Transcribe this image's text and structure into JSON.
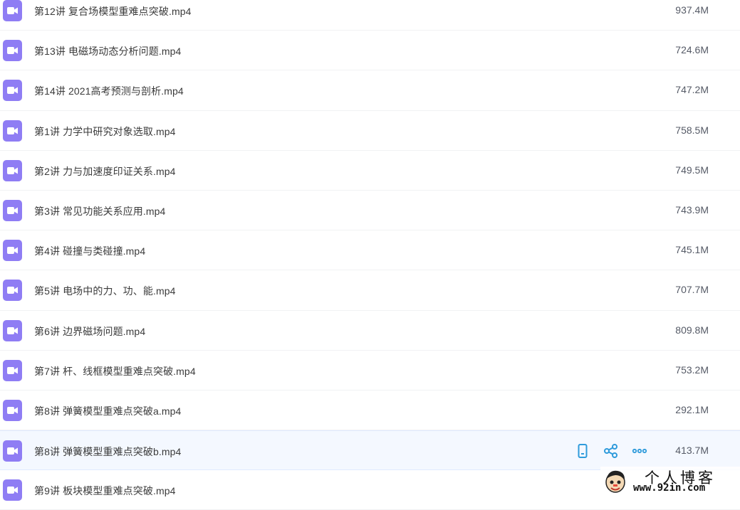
{
  "files": [
    {
      "name": "第12讲 复合场模型重难点突破.mp4",
      "size": "937.4M",
      "icon": "video-file-icon"
    },
    {
      "name": "第13讲 电磁场动态分析问题.mp4",
      "size": "724.6M",
      "icon": "video-file-icon"
    },
    {
      "name": "第14讲 2021高考预测与剖析.mp4",
      "size": "747.2M",
      "icon": "video-file-icon"
    },
    {
      "name": "第1讲 力学中研究对象选取.mp4",
      "size": "758.5M",
      "icon": "video-file-icon"
    },
    {
      "name": "第2讲 力与加速度印证关系.mp4",
      "size": "749.5M",
      "icon": "video-file-icon"
    },
    {
      "name": "第3讲 常见功能关系应用.mp4",
      "size": "743.9M",
      "icon": "video-file-icon"
    },
    {
      "name": "第4讲 碰撞与类碰撞.mp4",
      "size": "745.1M",
      "icon": "video-file-icon"
    },
    {
      "name": "第5讲 电场中的力、功、能.mp4",
      "size": "707.7M",
      "icon": "video-file-icon"
    },
    {
      "name": "第6讲 边界磁场问题.mp4",
      "size": "809.8M",
      "icon": "video-file-icon"
    },
    {
      "name": "第7讲 杆、线框模型重难点突破.mp4",
      "size": "753.2M",
      "icon": "video-file-icon"
    },
    {
      "name": "第8讲 弹簧模型重难点突破a.mp4",
      "size": "292.1M",
      "icon": "video-file-icon"
    },
    {
      "name": "第8讲 弹簧模型重难点突破b.mp4",
      "size": "413.7M",
      "icon": "video-file-icon"
    },
    {
      "name": "第9讲 板块模型重难点突破.mp4",
      "size": "",
      "icon": "video-file-icon"
    }
  ],
  "hover_row_index": 11,
  "row_actions": [
    {
      "name": "phone-icon",
      "label": "send to phone"
    },
    {
      "name": "share-icon",
      "label": "share"
    },
    {
      "name": "more-icon",
      "label": "more"
    }
  ],
  "watermark": {
    "title": "个人博客",
    "url": "www.92in.com"
  },
  "colors": {
    "icon_bg": "#8f7df4",
    "action_icon": "#2f9bdb",
    "hover_bg": "#f4f8ff",
    "text": "#3b3b3b"
  }
}
